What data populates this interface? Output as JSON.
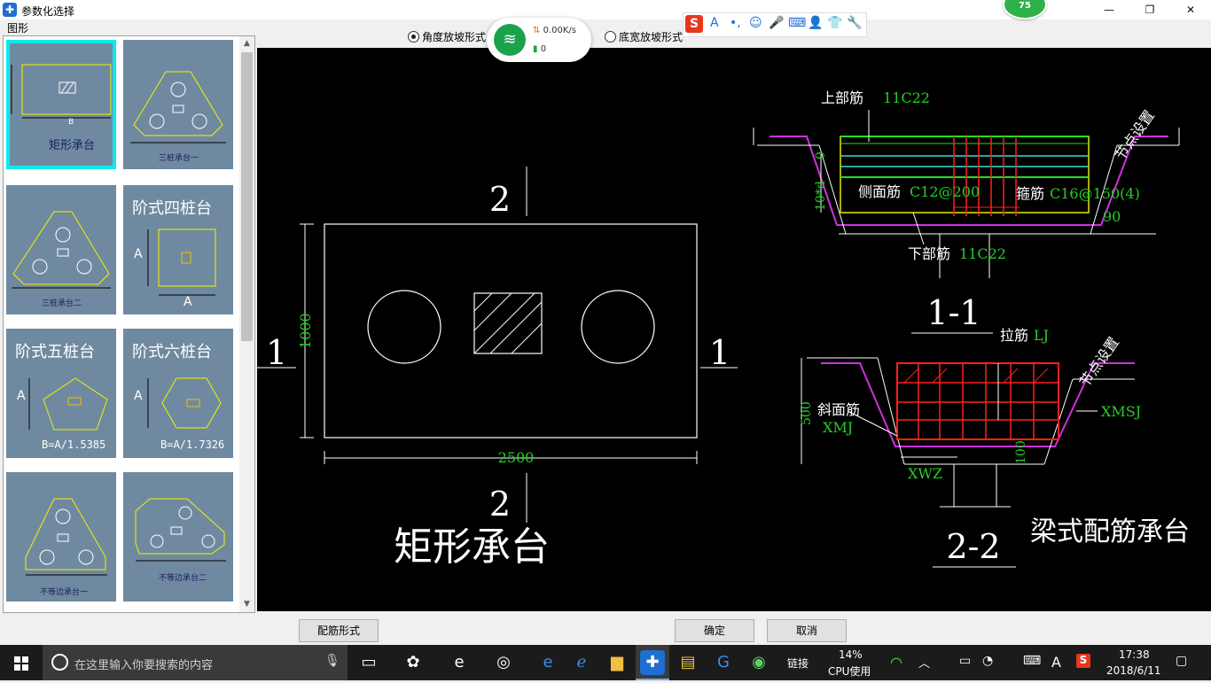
{
  "window": {
    "title": "参数化选择",
    "minimize": "—",
    "maximize": "❐",
    "close": "✕",
    "badge": "75"
  },
  "left_panel": {
    "label": "图形",
    "thumbnails": [
      {
        "caption": "矩形承台",
        "dim_label": "B"
      },
      {
        "caption": "三桩承台一"
      },
      {
        "caption": "三桩承台二"
      },
      {
        "caption": "阶式四桩台",
        "dim_a": "A",
        "dim_b": "A"
      },
      {
        "caption": "阶式五桩台",
        "dim_a": "A",
        "formula": "B=A/1.5385"
      },
      {
        "caption": "阶式六桩台",
        "dim_a": "A",
        "formula": "B=A/1.7326"
      },
      {
        "caption": "不等边承台一"
      },
      {
        "caption": "不等边承台二"
      }
    ]
  },
  "options": {
    "radio_angle": "角度放坡形式",
    "radio_bottom": "底宽放坡形式",
    "selected": "radio_angle"
  },
  "network": {
    "speed": "0.00K/s",
    "count": "0"
  },
  "ime": {
    "logo": "S",
    "icons": [
      "A",
      "•,",
      "☺",
      "🎤",
      "⌨",
      "👤",
      "👕",
      "🔧"
    ]
  },
  "drawing": {
    "section_mark_2": "2",
    "section_mark_1": "1",
    "dim_height": "1000",
    "dim_width": "2500",
    "main_title": "矩形承台",
    "sec11": {
      "top_bar": "上部筋",
      "top_bar_val": "11C22",
      "side_bar": "侧面筋",
      "side_bar_val": "C12@200",
      "stirrup": "箍筋",
      "stirrup_val": "C16@150(4)",
      "bottom_bar": "下部筋",
      "bottom_bar_val": "11C22",
      "node": "节点设置",
      "angle": "90",
      "dim_zero": "0",
      "dim_left": "10*d",
      "title": "1-1"
    },
    "sec22": {
      "tie_bar": "拉筋",
      "tie_bar_val": "LJ",
      "slope_bar": "斜面筋",
      "xmj": "XMJ",
      "xmsj": "XMSJ",
      "xwz": "XWZ",
      "dim_500": "500",
      "dim_100": "100",
      "node": "节点设置",
      "title": "2-2",
      "beam_title": "梁式配筋承台"
    }
  },
  "buttons": {
    "rebar_form": "配筋形式",
    "ok": "确定",
    "cancel": "取消"
  },
  "taskbar": {
    "search_placeholder": "在这里输入你要搜索的内容",
    "link_label": "链接",
    "cpu_percent": "14%",
    "cpu_label": "CPU使用",
    "input_lang": "A",
    "time": "17:38",
    "date": "2018/6/11"
  }
}
